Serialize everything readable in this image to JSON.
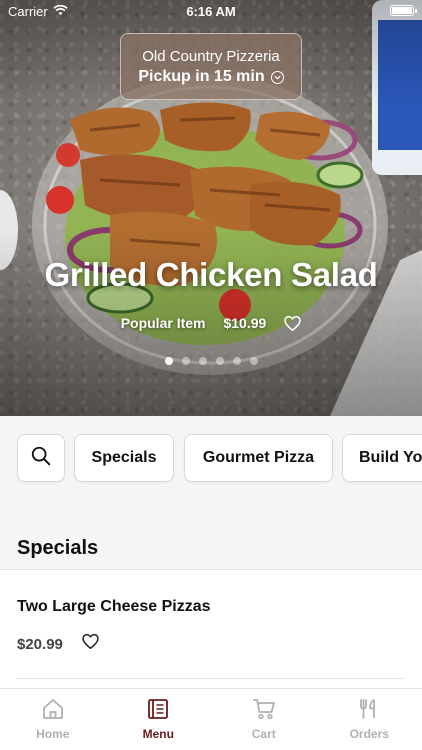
{
  "status_bar": {
    "carrier": "Carrier",
    "time": "6:16 AM"
  },
  "pickup": {
    "restaurant": "Old Country Pizzeria",
    "time": "Pickup in 15 min"
  },
  "hero": {
    "title": "Grilled Chicken Salad",
    "tag": "Popular Item",
    "price": "$10.99",
    "slide_count": 6,
    "active_slide": 0
  },
  "categories": {
    "search_icon": "search-icon",
    "items": [
      "Specials",
      "Gourmet Pizza",
      "Build Yo"
    ]
  },
  "menu": {
    "section_title": "Specials",
    "items": [
      {
        "name": "Two Large Cheese Pizzas",
        "price": "$20.99"
      }
    ]
  },
  "tabs": [
    {
      "label": "Home",
      "icon": "home-icon",
      "active": false
    },
    {
      "label": "Menu",
      "icon": "menu-book-icon",
      "active": true
    },
    {
      "label": "Cart",
      "icon": "cart-icon",
      "active": false
    },
    {
      "label": "Orders",
      "icon": "orders-icon",
      "active": false
    }
  ],
  "colors": {
    "accent": "#6b1a1a",
    "inactive": "#b0b0b0"
  }
}
